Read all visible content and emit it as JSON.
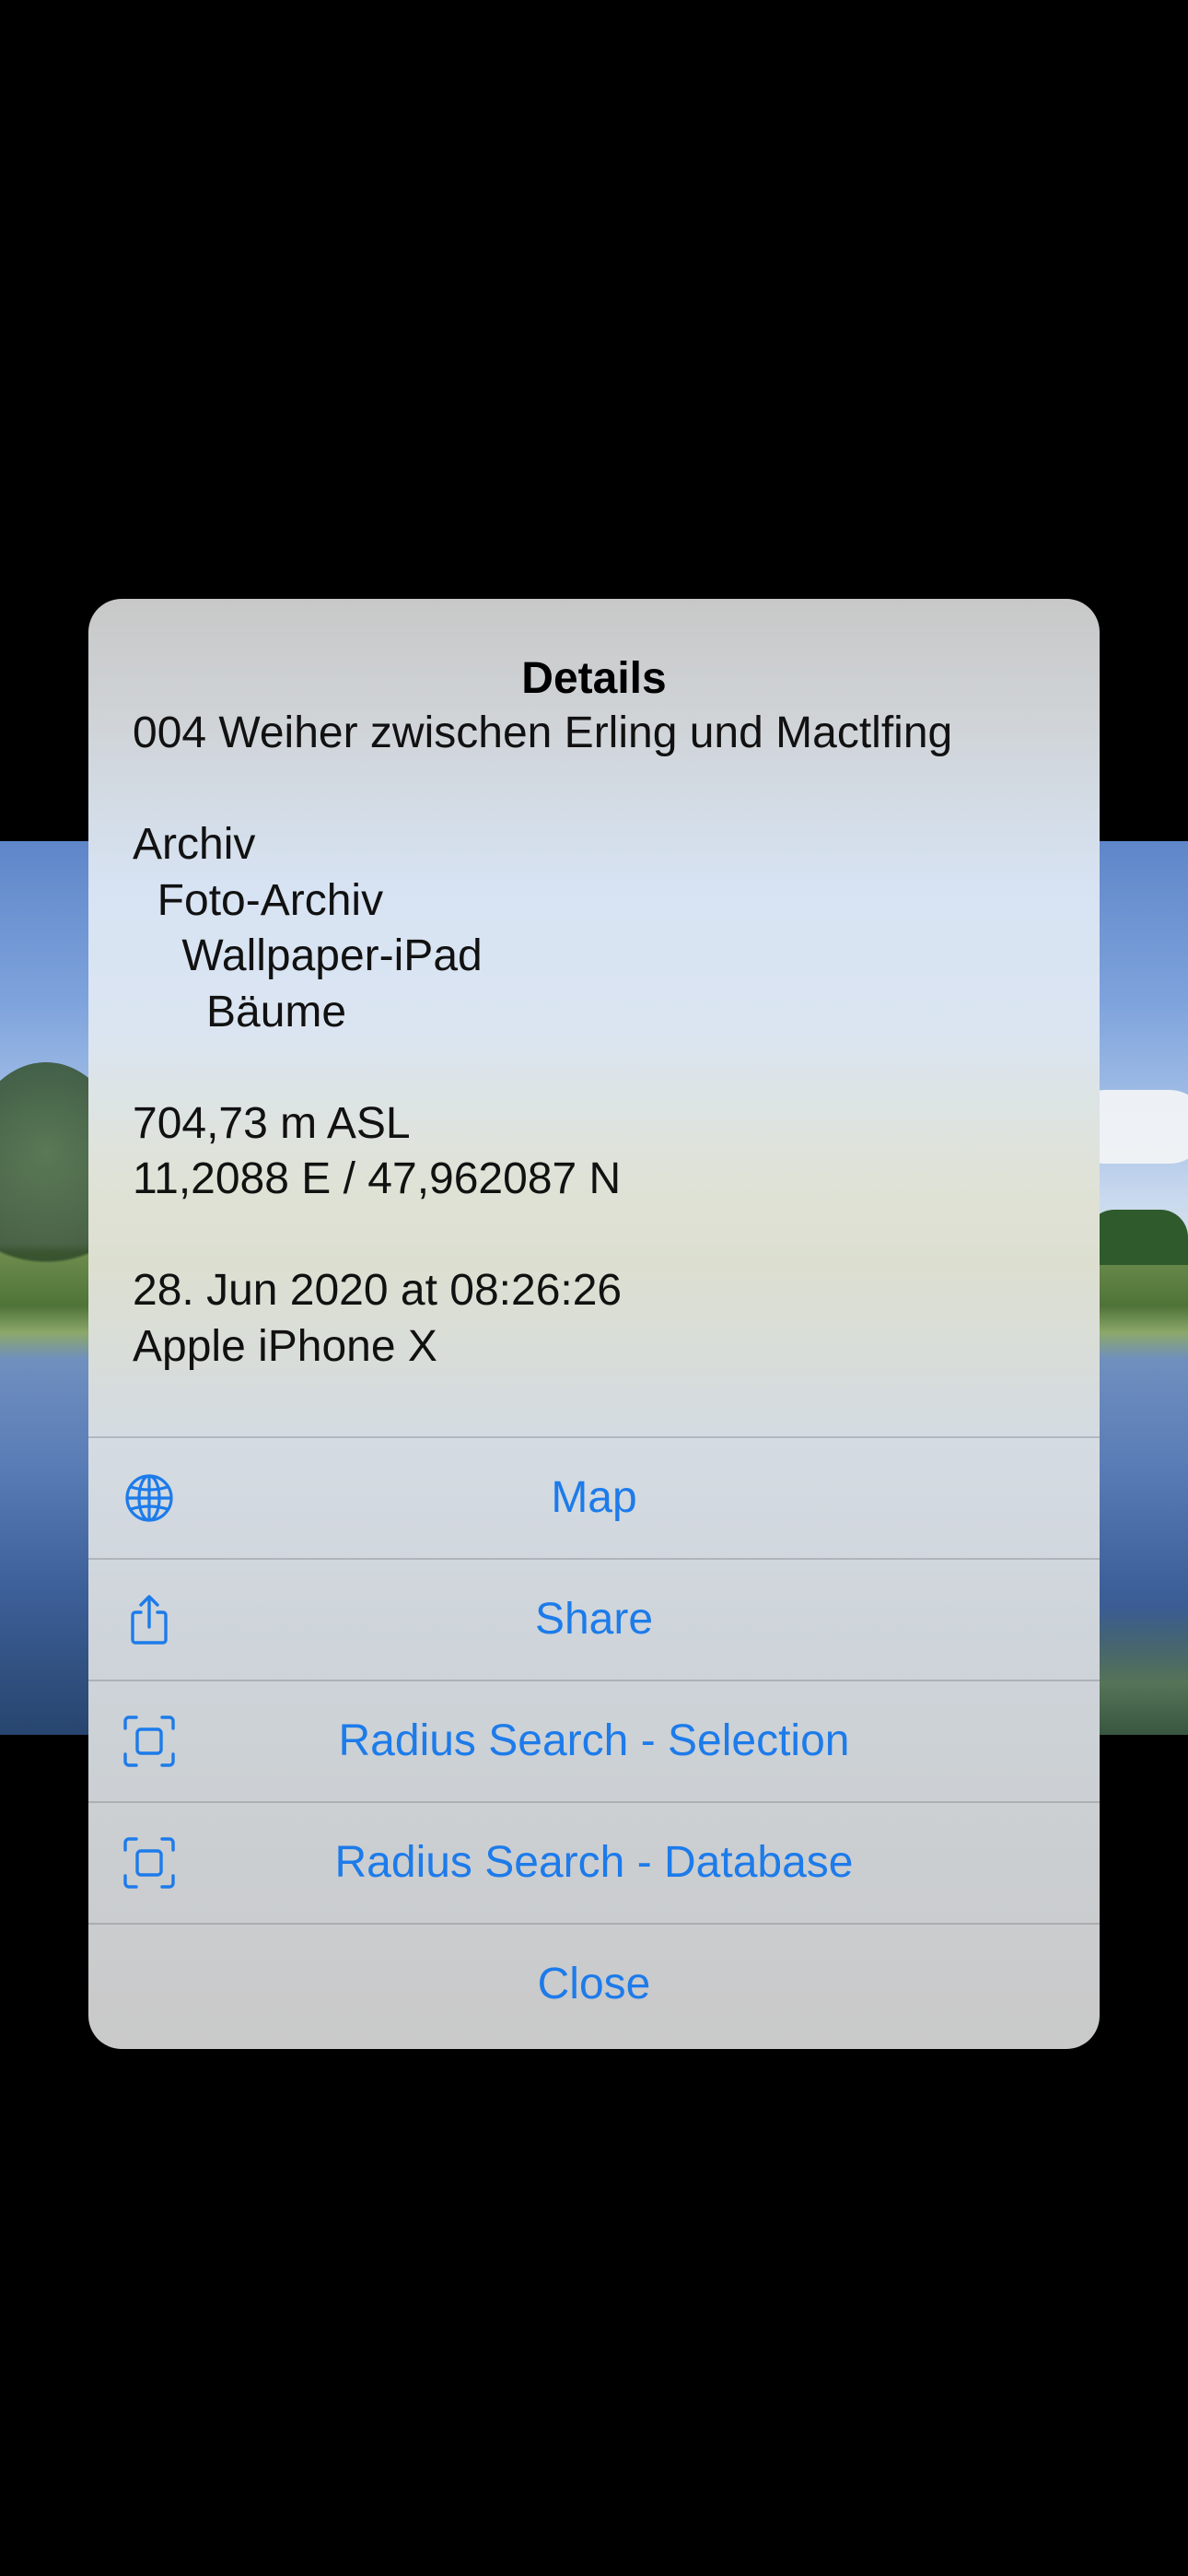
{
  "alert": {
    "title": "Details",
    "message_lines": [
      "004 Weiher zwischen Erling und Mactlfing",
      "",
      "Archiv",
      "  Foto-Archiv",
      "    Wallpaper-iPad",
      "      Bäume",
      "",
      "704,73 m ASL",
      "11,2088 E / 47,962087 N",
      "",
      "28. Jun 2020 at 08:26:26",
      "Apple iPhone X"
    ],
    "actions": [
      {
        "label": "Map",
        "icon": "globe-icon"
      },
      {
        "label": "Share",
        "icon": "share-icon"
      },
      {
        "label": "Radius Search - Selection",
        "icon": "viewfinder-icon"
      },
      {
        "label": "Radius Search - Database",
        "icon": "viewfinder-icon"
      },
      {
        "label": "Close",
        "icon": ""
      }
    ]
  },
  "colors": {
    "accent": "#1d7bea",
    "text": "#111111",
    "backdrop": "#000000"
  }
}
